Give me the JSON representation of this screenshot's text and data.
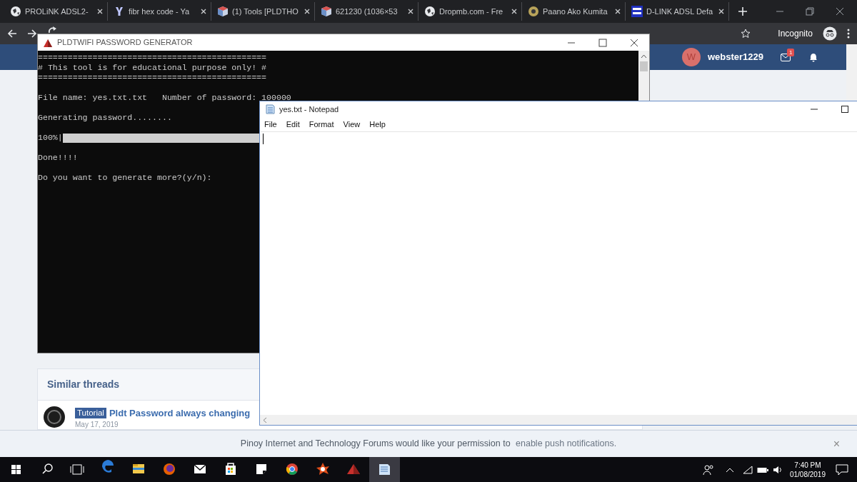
{
  "browser": {
    "tabs": [
      {
        "title": "PROLiNK ADSL2-",
        "kind": "globe"
      },
      {
        "title": "fibr hex code - Ya",
        "kind": "yahoo"
      },
      {
        "title": "(1) Tools [PLDTHO",
        "kind": "cube"
      },
      {
        "title": "621230 (1036×53",
        "kind": "cube"
      },
      {
        "title": "Dropmb.com - Fre",
        "kind": "globe"
      },
      {
        "title": "Paano Ako Kumita",
        "kind": "coin"
      },
      {
        "title": "D-LINK ADSL Defa",
        "kind": "pixel"
      }
    ],
    "incognito_label": "Incognito"
  },
  "site_header": {
    "avatar_letter": "W",
    "username": "webster1229",
    "mail_badge": "1"
  },
  "similar_threads": {
    "title": "Similar threads",
    "rows": [
      {
        "tag": "Tutorial",
        "title": "Pldt Password always changing",
        "date": "May 17, 2019"
      }
    ]
  },
  "notification_bar": {
    "message": "Pinoy Internet and Technology Forums would like your permission to",
    "link": "enable push notifications.",
    "close": "×"
  },
  "console": {
    "title": "PLDTWIFI PASSWORD GENERATOR",
    "lines": [
      {
        "kind": "text",
        "text": "=============================================="
      },
      {
        "kind": "text",
        "text": "# This tool is for educational purpose only! #"
      },
      {
        "kind": "text",
        "text": "=============================================="
      },
      {
        "kind": "blank"
      },
      {
        "kind": "text",
        "text": "File name: yes.txt.txt   Number of password: 100000"
      },
      {
        "kind": "blank"
      },
      {
        "kind": "text",
        "text": "Generating password........"
      },
      {
        "kind": "blank"
      },
      {
        "kind": "progress",
        "text": "100%|",
        "level": 1
      },
      {
        "kind": "blank"
      },
      {
        "kind": "text",
        "text": "Done!!!!"
      },
      {
        "kind": "blank"
      },
      {
        "kind": "text",
        "text": "Do you want to generate more?(y/n):"
      }
    ]
  },
  "notepad": {
    "title": "yes.txt - Notepad",
    "menu": [
      "File",
      "Edit",
      "Format",
      "View",
      "Help"
    ]
  },
  "taskbar": {
    "apps": [
      {
        "kind": "edge",
        "active": false
      },
      {
        "kind": "folder",
        "active": false
      },
      {
        "kind": "firefox",
        "active": false
      },
      {
        "kind": "mail",
        "active": false
      },
      {
        "kind": "store",
        "active": false
      },
      {
        "kind": "note",
        "active": false
      },
      {
        "kind": "chrome",
        "active": false
      },
      {
        "kind": "avast",
        "active": false
      },
      {
        "kind": "tent",
        "active": false
      },
      {
        "kind": "notepad",
        "active": true
      }
    ],
    "time": "7:40 PM",
    "date": "01/08/2019"
  }
}
